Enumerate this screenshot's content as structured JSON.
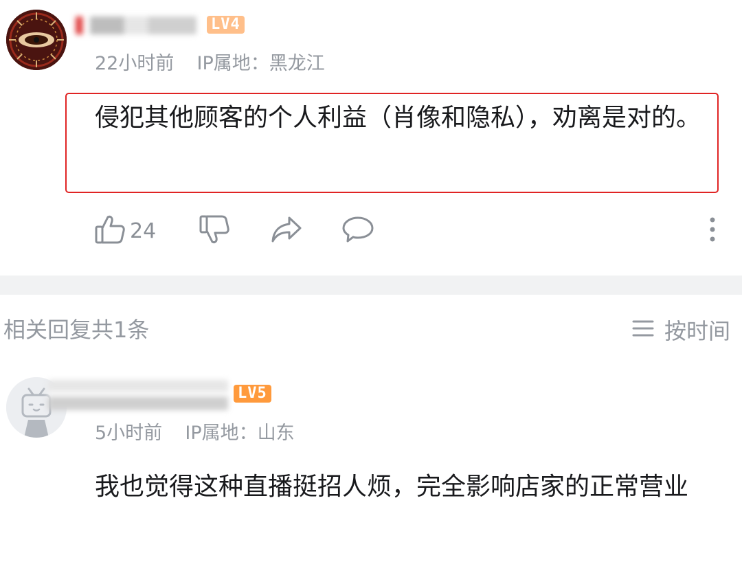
{
  "main_comment": {
    "level_badge": "LV4",
    "time": "22小时前",
    "ip_location": "IP属地：黑龙江",
    "text": "侵犯其他顾客的个人利益（肖像和隐私），劝离是对的。",
    "like_count": "24"
  },
  "replies_section": {
    "title": "相关回复共1条",
    "sort_label": "按时间"
  },
  "reply_comment": {
    "level_badge": "LV5",
    "time": "5小时前",
    "ip_location": "IP属地：山东",
    "text": "我也觉得这种直播挺招人烦，完全影响店家的正常营业"
  },
  "colors": {
    "highlight_border": "#e02424",
    "lv4_badge": "#ffbf8a",
    "lv5_badge": "#ff9a3c",
    "meta_text": "#9499a0"
  },
  "icons": [
    "thumbs-up-icon",
    "thumbs-down-icon",
    "share-icon",
    "reply-bubble-icon",
    "more-vertical-icon",
    "sort-lines-icon"
  ]
}
